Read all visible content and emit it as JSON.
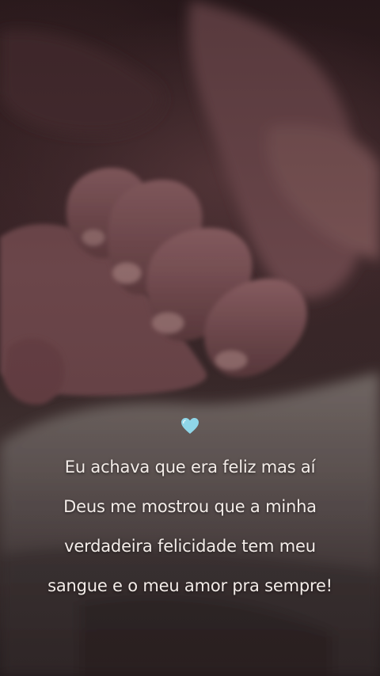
{
  "image": {
    "heart_icon": "light-blue-heart-icon",
    "heart_color": "#8fd6e8",
    "quote_lines": [
      "Eu achava que era feliz mas aí",
      "Deus me mostrou que a minha",
      "verdadeira felicidade tem meu",
      "sangue e o meu amor pra sempre!"
    ],
    "text_color": "#f4ede9"
  }
}
